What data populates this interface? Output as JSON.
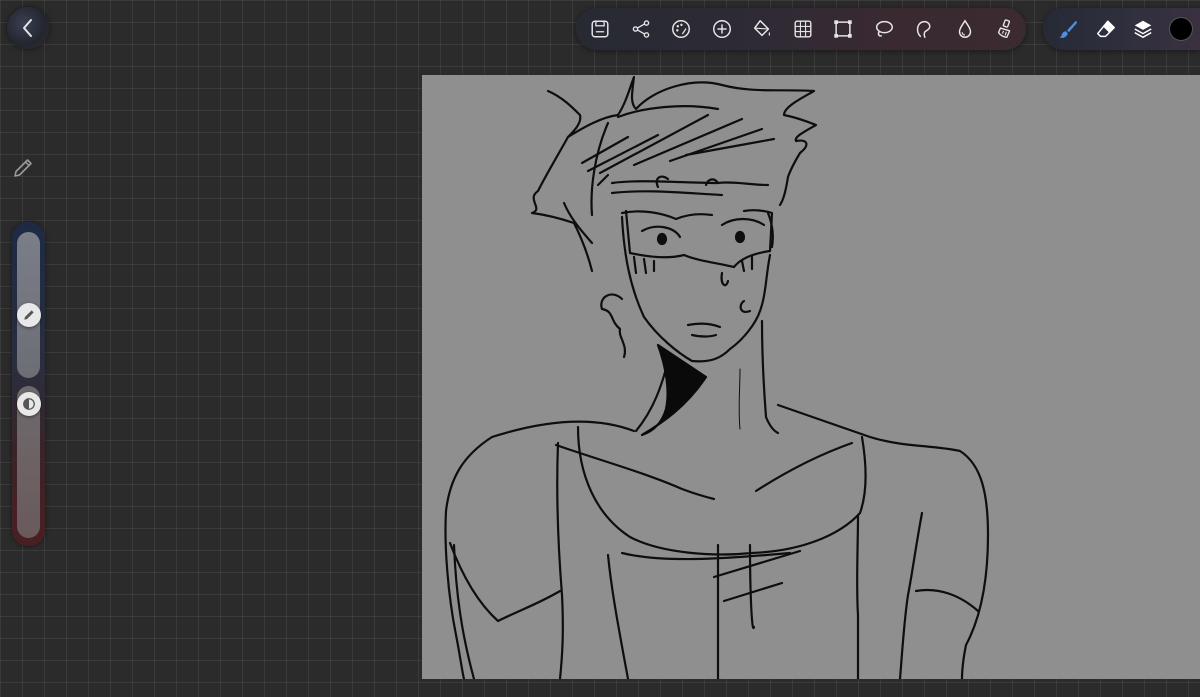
{
  "app": {
    "name": "Drawing canvas",
    "background_color": "#2b2b2b",
    "canvas_color": "#8f8f8f",
    "accent_color": "#4a90e2"
  },
  "top_left": {
    "back_icon": "chevron-left-icon"
  },
  "toolbar": {
    "tools": [
      {
        "name": "save",
        "icon": "save-icon"
      },
      {
        "name": "share",
        "icon": "share-icon"
      },
      {
        "name": "adjustments",
        "icon": "palette-icon"
      },
      {
        "name": "add",
        "icon": "plus-circle-icon"
      },
      {
        "name": "fill",
        "icon": "paint-bucket-icon"
      },
      {
        "name": "grid",
        "icon": "grid-icon"
      },
      {
        "name": "transform",
        "icon": "transform-icon"
      },
      {
        "name": "lasso",
        "icon": "lasso-icon"
      },
      {
        "name": "smudge",
        "icon": "smudge-icon"
      },
      {
        "name": "blur",
        "icon": "droplet-icon"
      },
      {
        "name": "clean",
        "icon": "brush-clean-icon"
      }
    ]
  },
  "right_toolbar": {
    "tools": [
      {
        "name": "brush",
        "icon": "brush-icon",
        "active": true
      },
      {
        "name": "eraser",
        "icon": "eraser-icon",
        "active": false
      },
      {
        "name": "layers",
        "icon": "layers-icon",
        "active": false
      }
    ],
    "current_color": "#000000"
  },
  "side_panel": {
    "mode_icon": "pencil-icon",
    "size_slider": {
      "icon": "pencil-icon",
      "value": 0.42
    },
    "opacity_slider": {
      "icon": "contrast-icon",
      "value": 0.95
    }
  }
}
